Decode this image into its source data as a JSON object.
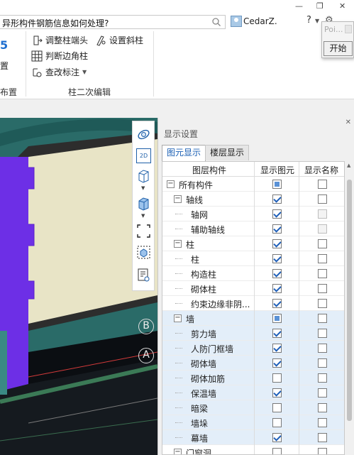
{
  "titlebar": {
    "search_query": "异形构件钢筋信息如何处理?",
    "user_name": "CedarZ.",
    "help_label": "?"
  },
  "ribbon": {
    "left_partial_icon_label": "5",
    "left_partial_text": "置",
    "left_group_partial_label": "布置",
    "items": {
      "adjust_column_end": "调整柱端头",
      "set_inclined_column": "设置斜柱",
      "judge_corner_column": "判断边角柱",
      "modify_annotation": "查改标注"
    },
    "group_label": "柱二次编辑"
  },
  "popup": {
    "input_placeholder": "Poi...",
    "start_button": "开始"
  },
  "panel": {
    "title": "显示设置",
    "tabs": [
      {
        "label": "图元显示",
        "active": true
      },
      {
        "label": "楼层显示",
        "active": false
      }
    ],
    "columns": [
      "图层构件",
      "显示图元",
      "显示名称"
    ],
    "rows": [
      {
        "label": "所有构件",
        "level": 0,
        "expander": "−",
        "show": "partial",
        "name": "unchecked",
        "highlight": false
      },
      {
        "label": "轴线",
        "level": 1,
        "expander": "−",
        "show": "checked",
        "name": "unchecked",
        "highlight": false
      },
      {
        "label": "轴网",
        "level": 2,
        "expander": "",
        "show": "checked",
        "name": "disabled",
        "highlight": false
      },
      {
        "label": "辅助轴线",
        "level": 2,
        "expander": "",
        "show": "checked",
        "name": "disabled",
        "highlight": false
      },
      {
        "label": "柱",
        "level": 1,
        "expander": "−",
        "show": "checked",
        "name": "unchecked",
        "highlight": false
      },
      {
        "label": "柱",
        "level": 2,
        "expander": "",
        "show": "checked",
        "name": "unchecked",
        "highlight": false
      },
      {
        "label": "构造柱",
        "level": 2,
        "expander": "",
        "show": "checked",
        "name": "unchecked",
        "highlight": false
      },
      {
        "label": "砌体柱",
        "level": 2,
        "expander": "",
        "show": "checked",
        "name": "unchecked",
        "highlight": false
      },
      {
        "label": "约束边缘非阴...",
        "level": 2,
        "expander": "",
        "show": "checked",
        "name": "unchecked",
        "highlight": false
      },
      {
        "label": "墙",
        "level": 1,
        "expander": "−",
        "show": "partial",
        "name": "unchecked",
        "highlight": true
      },
      {
        "label": "剪力墙",
        "level": 2,
        "expander": "",
        "show": "checked",
        "name": "unchecked",
        "highlight": true
      },
      {
        "label": "人防门框墙",
        "level": 2,
        "expander": "",
        "show": "checked",
        "name": "unchecked",
        "highlight": true
      },
      {
        "label": "砌体墙",
        "level": 2,
        "expander": "",
        "show": "checked",
        "name": "unchecked",
        "highlight": true
      },
      {
        "label": "砌体加筋",
        "level": 2,
        "expander": "",
        "show": "unchecked",
        "name": "unchecked",
        "highlight": true
      },
      {
        "label": "保温墙",
        "level": 2,
        "expander": "",
        "show": "checked",
        "name": "unchecked",
        "highlight": true
      },
      {
        "label": "暗梁",
        "level": 2,
        "expander": "",
        "show": "unchecked",
        "name": "unchecked",
        "highlight": true
      },
      {
        "label": "墙垛",
        "level": 2,
        "expander": "",
        "show": "unchecked",
        "name": "unchecked",
        "highlight": true
      },
      {
        "label": "幕墙",
        "level": 2,
        "expander": "",
        "show": "checked",
        "name": "unchecked",
        "highlight": true
      },
      {
        "label": "门窗洞",
        "level": 1,
        "expander": "−",
        "show": "unchecked",
        "name": "unchecked",
        "highlight": false
      }
    ]
  },
  "viewport": {
    "axis_labels": [
      "B",
      "A"
    ],
    "toolbar_2d_label": "2D"
  }
}
